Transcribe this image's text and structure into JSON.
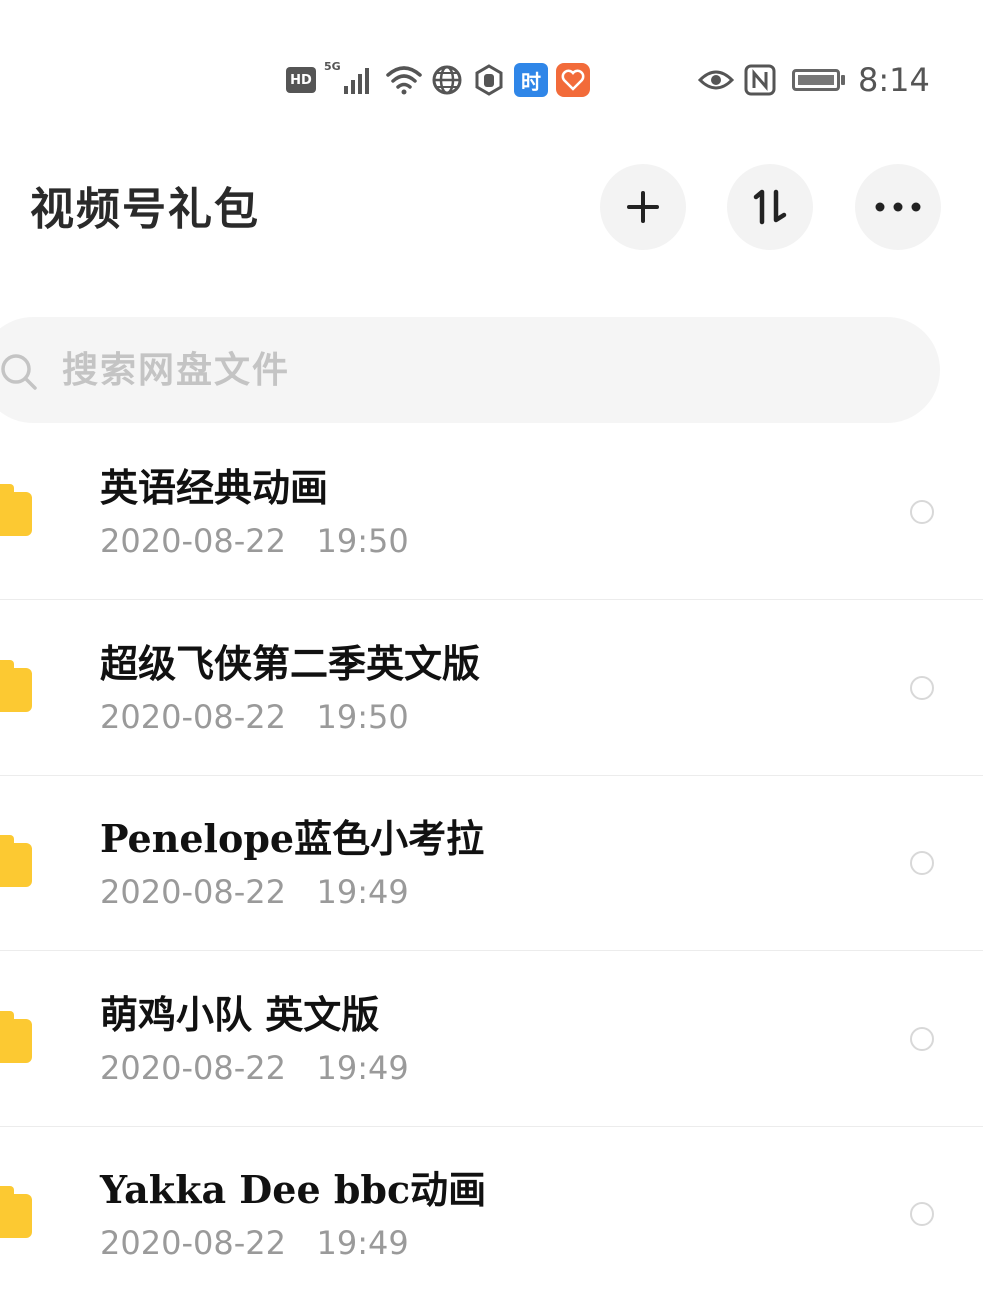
{
  "status_bar": {
    "hd_label": "HD",
    "network_label": "5G",
    "shi_label": "时",
    "time": "8:14",
    "icons": [
      "hd-icon",
      "5g-signal-icon",
      "wifi-icon",
      "globe-icon",
      "hand-icon",
      "shi-app-icon",
      "health-app-icon",
      "eye-icon",
      "nfc-icon",
      "battery-icon"
    ]
  },
  "header": {
    "title": "视频号礼包",
    "buttons": [
      "add-icon",
      "sort-icon",
      "more-icon"
    ]
  },
  "search": {
    "placeholder": "搜索网盘文件"
  },
  "files": [
    {
      "name": "英语经典动画",
      "date": "2020-08-22   19:50"
    },
    {
      "name": "超级飞侠第二季英文版",
      "date": "2020-08-22   19:50"
    },
    {
      "name": "Penelope蓝色小考拉",
      "date": "2020-08-22   19:49"
    },
    {
      "name": "萌鸡小队 英文版",
      "date": "2020-08-22   19:49"
    },
    {
      "name": "Yakka Dee bbc动画",
      "date": "2020-08-22   19:49"
    }
  ],
  "colors": {
    "folder": "#fcc932",
    "date_text": "#9a9a9a",
    "button_bg": "#f3f3f3",
    "search_bg": "#f5f5f5"
  }
}
